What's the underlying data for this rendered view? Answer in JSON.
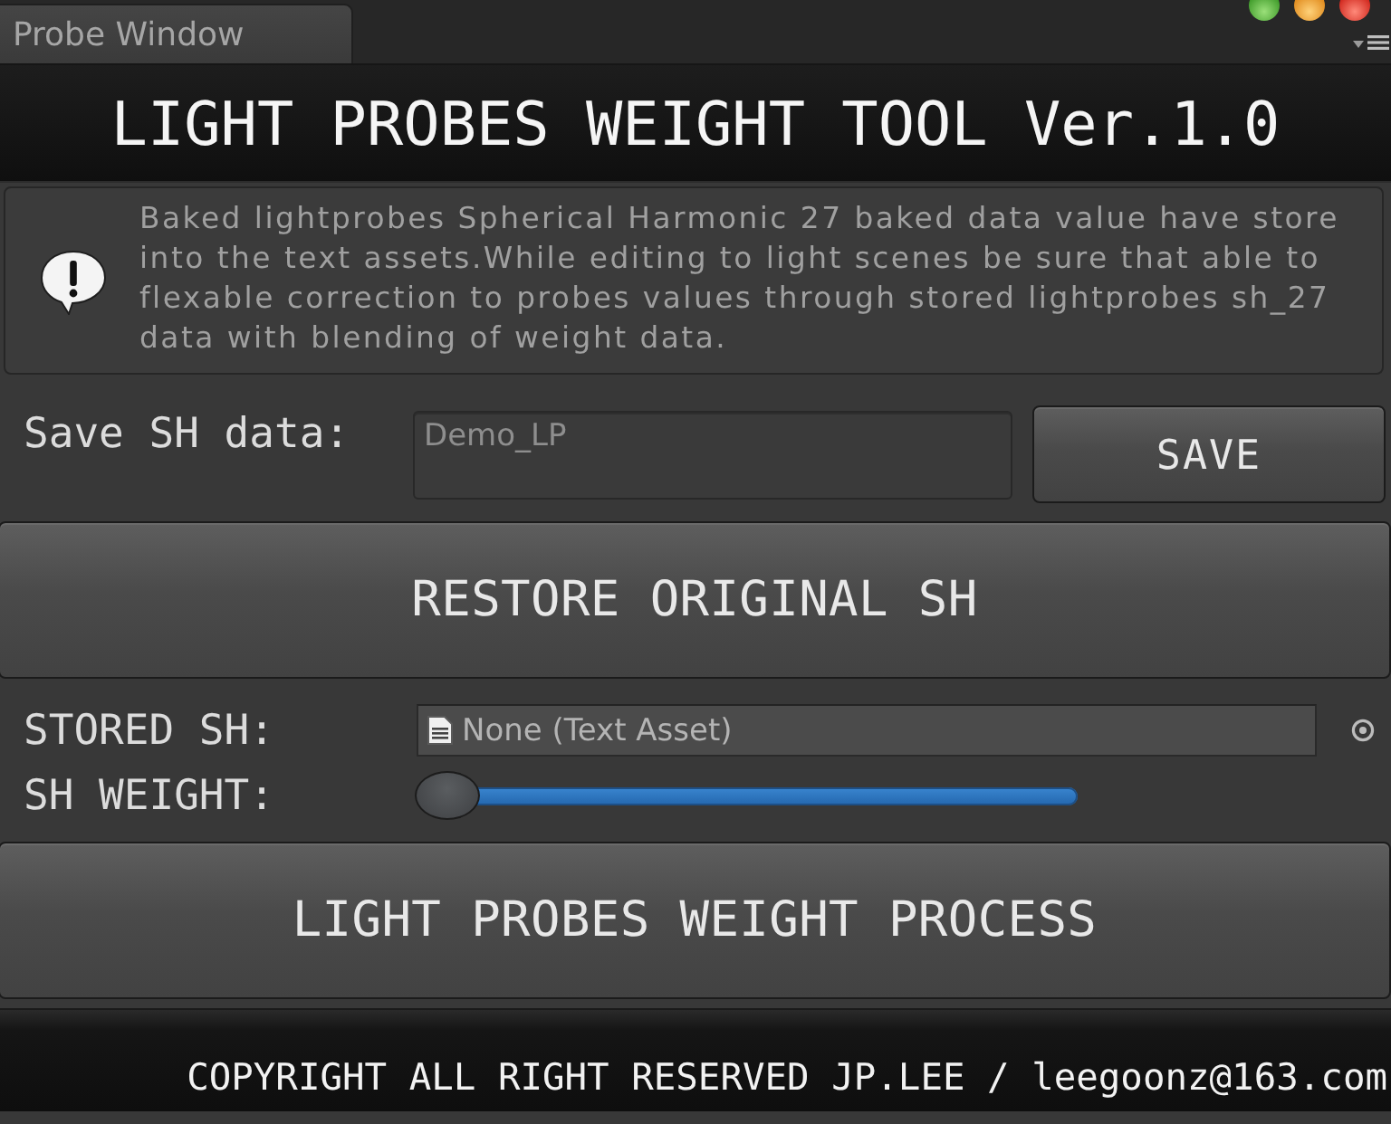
{
  "window": {
    "tab": "Probe Window"
  },
  "header": {
    "title": "LIGHT PROBES WEIGHT TOOL Ver.1.0"
  },
  "help_box": {
    "message": "Baked lightprobes Spherical Harmonic 27 baked data value have store into the text assets.While editing to light scenes be sure that able to flexable correction to probes values through stored lightprobes sh_27 data with blending of weight data."
  },
  "save_row": {
    "label": "Save SH data:",
    "value": "Demo_LP",
    "button": "SAVE"
  },
  "restore_button": "RESTORE ORIGINAL SH",
  "stored_sh": {
    "label": "STORED SH:",
    "value": "None (Text Asset)"
  },
  "sh_weight": {
    "label": "SH WEIGHT:",
    "level": 0
  },
  "process_button": "LIGHT PROBES WEIGHT PROCESS",
  "footer": {
    "copyright": "COPYRIGHT ALL RIGHT RESERVED JP.LEE / leegoonz@163.com"
  }
}
